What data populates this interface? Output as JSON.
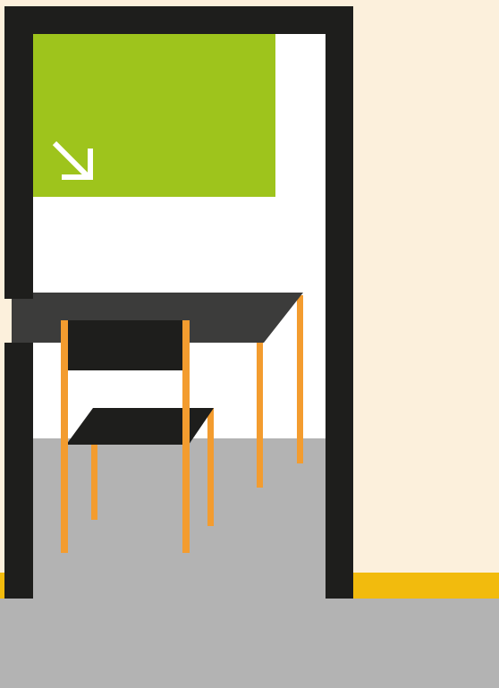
{
  "palette": {
    "wall": "#FCF0DC",
    "floor": "#B3B3B3",
    "baseboard": "#F2BB0D",
    "doorframe": "#1E1E1C",
    "doorway_interior": "#FFFFFF",
    "sign": "#9EC41C",
    "sign_arrow": "#FFFFFF",
    "desk_top": "#3C3C3B",
    "chair_black": "#1E1E1C",
    "legs": "#F39C2F"
  },
  "icons": {
    "sign_arrow": "arrow-down-right-icon"
  }
}
